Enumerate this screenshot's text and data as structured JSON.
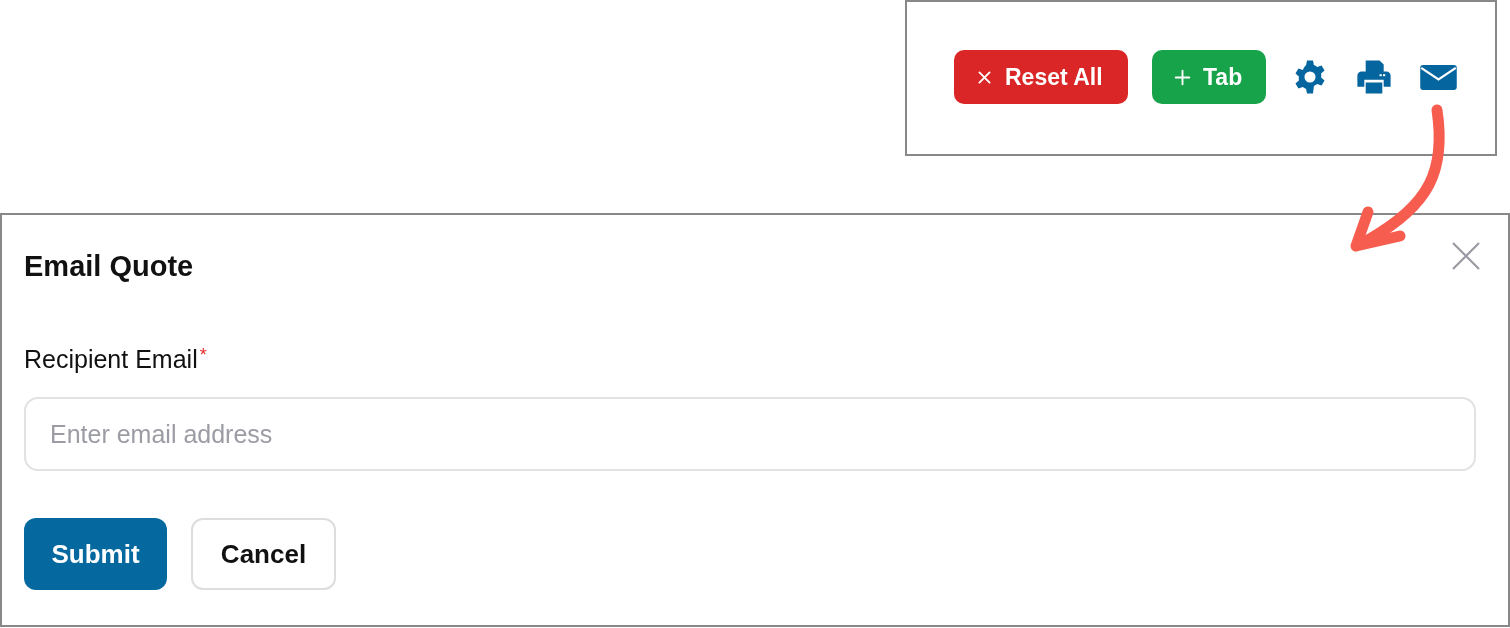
{
  "toolbar": {
    "items": [
      {
        "kind": "reset",
        "label": "Reset All"
      },
      {
        "kind": "add",
        "label": "Tab"
      },
      {
        "kind": "settings"
      },
      {
        "kind": "print"
      },
      {
        "kind": "email"
      }
    ]
  },
  "dialog": {
    "title": "Email Quote",
    "field": {
      "label": "Recipient Email",
      "required_mark": "*",
      "placeholder": "Enter email address"
    },
    "buttons": [
      {
        "kind": "primary",
        "label": "Submit"
      },
      {
        "kind": "secondary",
        "label": "Cancel"
      }
    ]
  }
}
